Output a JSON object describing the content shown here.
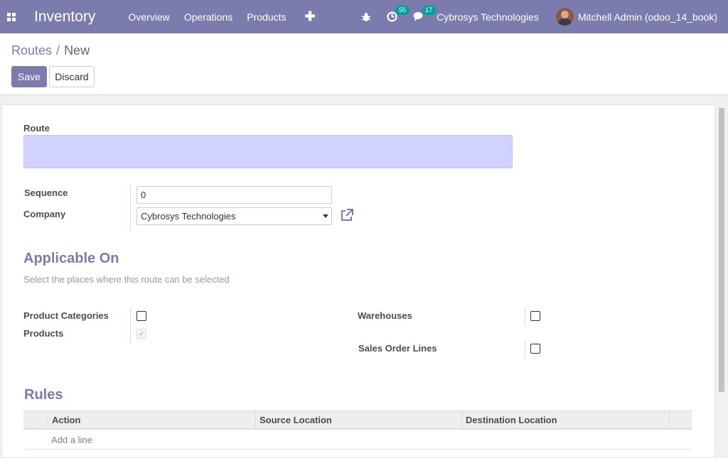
{
  "navbar": {
    "app_title": "Inventory",
    "menu": [
      "Overview",
      "Operations",
      "Products"
    ],
    "activity_count": "55",
    "message_count": "17",
    "company": "Cybrosys Technologies",
    "user": "Mitchell Admin (odoo_14_book)",
    "icons": [
      "apps-grid-icon",
      "plus-icon",
      "bug-icon",
      "clock-icon",
      "chat-icon"
    ]
  },
  "breadcrumb": {
    "parent": "Routes",
    "separator": "/",
    "current": "New"
  },
  "actions": {
    "save": "Save",
    "discard": "Discard"
  },
  "form": {
    "route_label": "Route",
    "route_value": "",
    "sequence_label": "Sequence",
    "sequence_value": "0",
    "company_label": "Company",
    "company_value": "Cybrosys Technologies"
  },
  "applicable_on": {
    "title": "Applicable On",
    "subtitle": "Select the places where this route can be selected",
    "product_categories_label": "Product Categories",
    "products_label": "Products",
    "warehouses_label": "Warehouses",
    "sales_order_lines_label": "Sales Order Lines",
    "product_categories_checked": false,
    "products_checked": true,
    "warehouses_checked": false,
    "sales_order_lines_checked": false
  },
  "rules": {
    "title": "Rules",
    "columns": [
      "Action",
      "Source Location",
      "Destination Location"
    ],
    "add_line": "Add a line"
  },
  "colors": {
    "brand": "#7c7bad",
    "badge": "#00a09d",
    "required_field": "#d2d2ff"
  }
}
